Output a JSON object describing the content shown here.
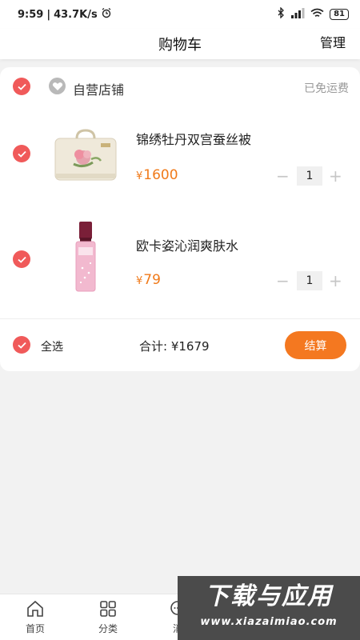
{
  "status_bar": {
    "time": "9:59",
    "speed": "43.7K/s",
    "battery": "81"
  },
  "nav": {
    "title": "购物车",
    "manage": "管理"
  },
  "store": {
    "name": "自营店铺",
    "shipping": "已免运费"
  },
  "items": [
    {
      "name": "锦绣牡丹双宫蚕丝被",
      "price_symbol": "¥",
      "price": "1600",
      "quantity": "1",
      "image_icon": "silk-quilt-box-image"
    },
    {
      "name": "欧卡姿沁润爽肤水",
      "price_symbol": "¥",
      "price": "79",
      "quantity": "1",
      "image_icon": "toner-bottle-image"
    }
  ],
  "footer": {
    "select_all": "全选",
    "total": "合计: ¥1679",
    "checkout": "结算"
  },
  "tabs": [
    {
      "label": "首页",
      "icon": "home-icon"
    },
    {
      "label": "分类",
      "icon": "category-grid-icon"
    },
    {
      "label": "消",
      "icon": "message-icon"
    }
  ],
  "watermark": {
    "main": "下载与应用",
    "url": "www.xiazaimiao.com"
  },
  "colors": {
    "accent_red": "#f05a5a",
    "price_orange": "#f07a1a",
    "checkout_orange": "#f47820"
  }
}
